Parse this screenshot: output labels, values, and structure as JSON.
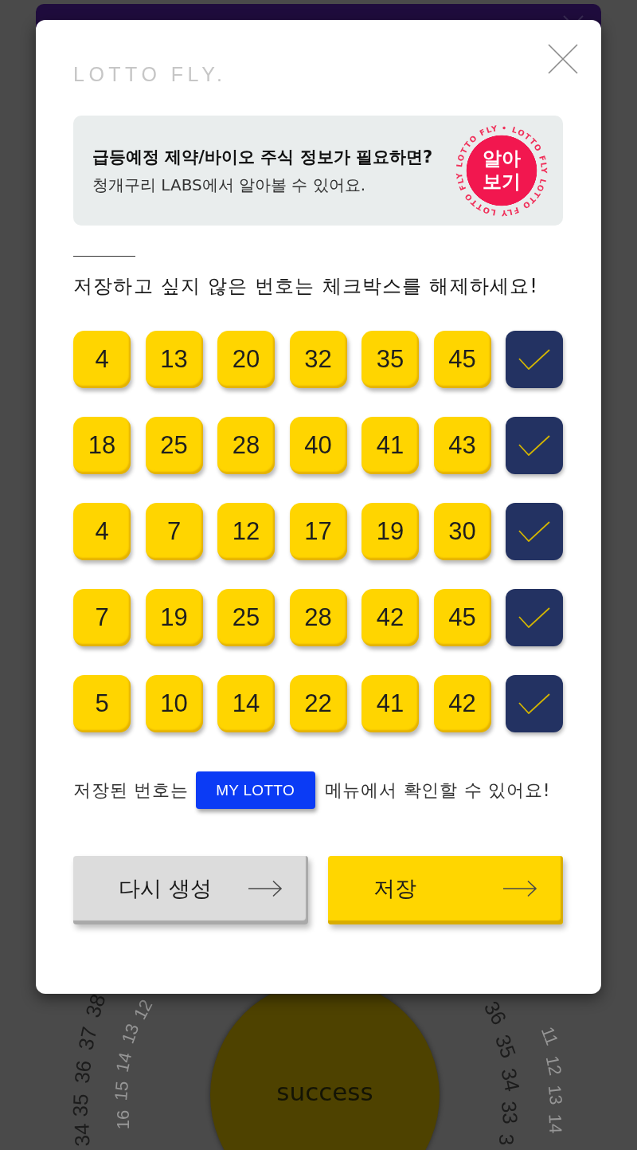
{
  "background": {
    "wheel_left_outer": [
      "38",
      "37",
      "36",
      "35",
      "34"
    ],
    "wheel_left_inner": [
      "12",
      "13",
      "14",
      "15",
      "16"
    ],
    "wheel_right_outer": [
      "36",
      "35",
      "34",
      "33",
      "3"
    ],
    "wheel_right_inner": [
      "11",
      "12",
      "13",
      "14"
    ],
    "center_button": "success"
  },
  "dialog": {
    "logo": "LOTTO FLY.",
    "banner": {
      "title": "급등예정 제약/바이오 주식 정보가 필요하면?",
      "subtitle": "청개구리 LABS에서 알아볼 수 있어요.",
      "ring_text": "• LOTTO FLY LOTTO FLY LOTTO FLY LOTTO FLY",
      "badge": "알아보기"
    },
    "instruction": "저장하고 싶지 않은 번호는 체크박스를 해제하세요!",
    "rows": [
      {
        "numbers": [
          "4",
          "13",
          "20",
          "32",
          "35",
          "45"
        ],
        "checked": true
      },
      {
        "numbers": [
          "18",
          "25",
          "28",
          "40",
          "41",
          "43"
        ],
        "checked": true
      },
      {
        "numbers": [
          "4",
          "7",
          "12",
          "17",
          "19",
          "30"
        ],
        "checked": true
      },
      {
        "numbers": [
          "7",
          "19",
          "25",
          "28",
          "42",
          "45"
        ],
        "checked": true
      },
      {
        "numbers": [
          "5",
          "10",
          "14",
          "22",
          "41",
          "42"
        ],
        "checked": true
      }
    ],
    "note": {
      "before": "저장된 번호는",
      "button": "MY LOTTO",
      "after": "메뉴에서 확인할 수 있어요!"
    },
    "buttons": [
      {
        "label": "다시 생성",
        "kind": "secondary"
      },
      {
        "label": "저장",
        "kind": "primary"
      }
    ]
  }
}
